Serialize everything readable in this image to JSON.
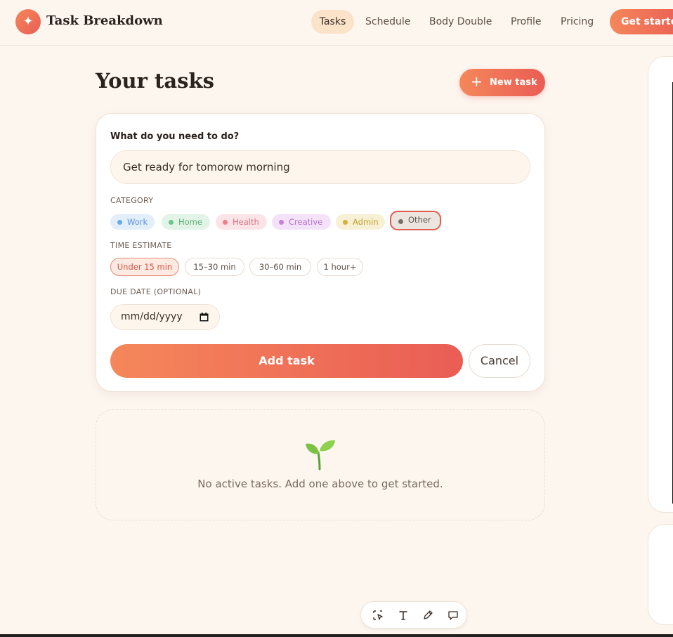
{
  "header": {
    "logo_glyph": "✦",
    "title": "Task Breakdown",
    "nav": [
      "Tasks",
      "Schedule",
      "Body Double",
      "Profile",
      "Pricing"
    ],
    "cta": "Get started"
  },
  "main": {
    "title": "Your tasks",
    "new_task": "New task"
  },
  "form": {
    "question": "What do you need to do?",
    "task_value": "Get ready for tomorow morning",
    "category_label": "CATEGORY",
    "categories": [
      "Work",
      "Home",
      "Health",
      "Creative",
      "Admin",
      "Other"
    ],
    "selected_category": "Other",
    "time_label": "TIME ESTIMATE",
    "times": [
      "Under 15 min",
      "15–30 min",
      "30–60 min",
      "1 hour+"
    ],
    "selected_time": "Under 15 min",
    "due_label": "DUE DATE (OPTIONAL)",
    "due_placeholder": "mm/dd/yyyy",
    "add": "Add task",
    "cancel": "Cancel"
  },
  "empty": {
    "text": "No active tasks. Add one above to get started."
  },
  "colors": {
    "accent_start": "#f5875a",
    "accent_end": "#ea5d55",
    "work": "#6aa8e8",
    "home": "#6cc58a",
    "health": "#ef7f8c",
    "creative": "#c77fdc",
    "admin": "#d2b13e",
    "other": "#7a6e68"
  }
}
